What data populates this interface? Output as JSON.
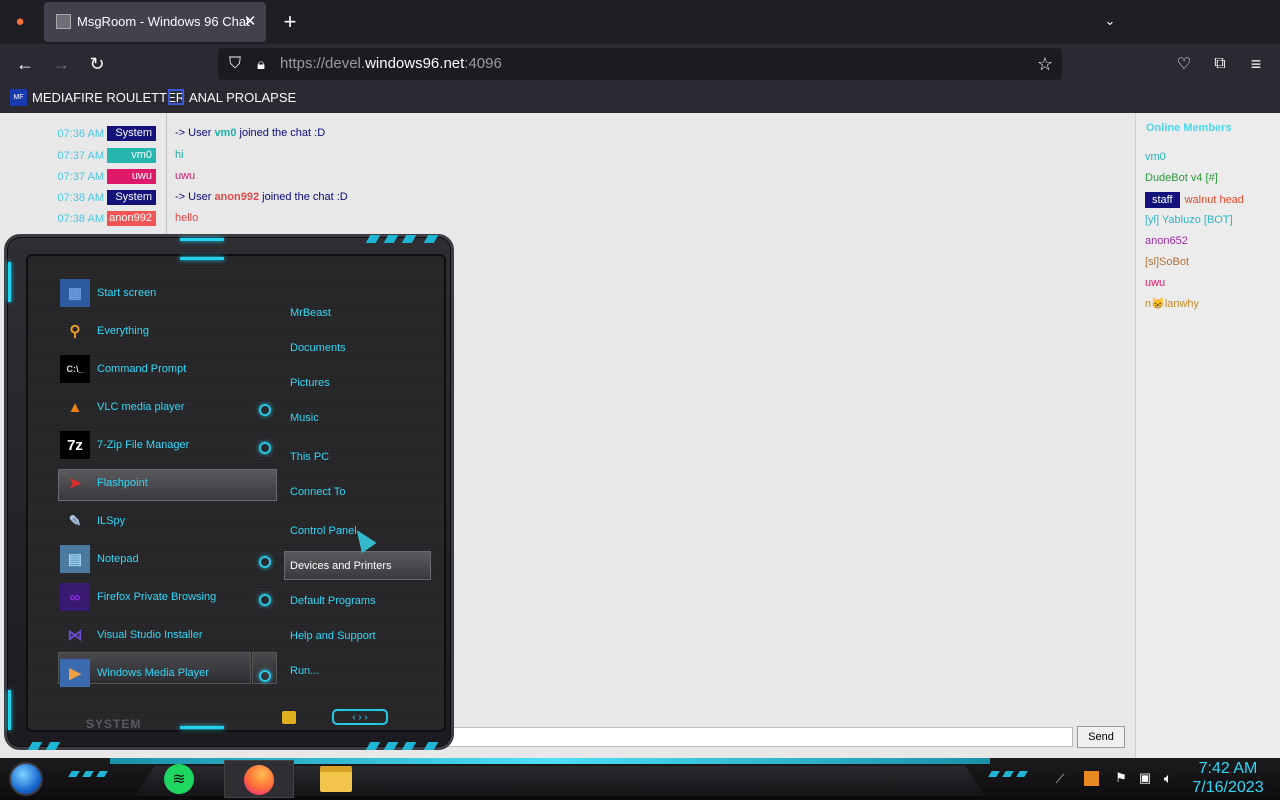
{
  "browser": {
    "tab_title": "MsgRoom - Windows 96 Chat",
    "url_prefix": "https://devel.",
    "url_host": "windows96.net",
    "url_port": ":4096",
    "bookmarks": [
      {
        "label": "MEDIAFIRE ROULETTER",
        "icon_text": "MF"
      },
      {
        "label": "ANAL PROLAPSE",
        "icon_text": ""
      }
    ]
  },
  "chat": {
    "messages": [
      {
        "time": "07:36 AM",
        "user": "System",
        "color": "#12127a",
        "text_pre": "-> User ",
        "text_user": "vm0",
        "text_user_color": "#1ab0a8",
        "text_post": " joined the chat :D",
        "text_color": "#0b0b7a"
      },
      {
        "time": "07:37 AM",
        "user": "vm0",
        "color": "#25b6b0",
        "text_pre": "hi",
        "text_user": "",
        "text_user_color": "",
        "text_post": "",
        "text_color": "#25a8a2"
      },
      {
        "time": "07:37 AM",
        "user": "uwu",
        "color": "#e0186a",
        "text_pre": "uwu",
        "text_user": "",
        "text_user_color": "",
        "text_post": "",
        "text_color": "#d21a6a"
      },
      {
        "time": "07:38 AM",
        "user": "System",
        "color": "#12127a",
        "text_pre": "-> User ",
        "text_user": "anon992",
        "text_user_color": "#e0484a",
        "text_post": " joined the chat :D",
        "text_color": "#0b0b7a"
      },
      {
        "time": "07:38 AM",
        "user": "anon992",
        "color": "#f05454",
        "text_pre": "hello",
        "text_user": "",
        "text_user_color": "",
        "text_post": "",
        "text_color": "#e04040"
      }
    ],
    "send_label": "Send",
    "input_value": ""
  },
  "members": {
    "header": "Online Members",
    "list": [
      {
        "name": "vm0",
        "color": "#25b6b0",
        "badge": ""
      },
      {
        "name": "DudeBot v4 [#]",
        "color": "#2b9a3a",
        "badge": ""
      },
      {
        "name": "walnut head",
        "color": "#e04a2a",
        "badge": "staff"
      },
      {
        "name": "[yl] Yabluzo [BOT]",
        "color": "#2fb6c8",
        "badge": ""
      },
      {
        "name": "anon652",
        "color": "#9a2aa8",
        "badge": ""
      },
      {
        "name": "[sl]SoBot",
        "color": "#b0723a",
        "badge": ""
      },
      {
        "name": "uwu",
        "color": "#e0186a",
        "badge": ""
      },
      {
        "name": "n😸lanwhy",
        "color": "#c08a2a",
        "badge": ""
      }
    ]
  },
  "start_menu": {
    "left_items": [
      {
        "label": "Start screen",
        "icon": "start-screen-icon",
        "glyph": "▦",
        "has_submenu": false
      },
      {
        "label": "Everything",
        "icon": "magnifier-icon",
        "glyph": "⚲",
        "has_submenu": false
      },
      {
        "label": "Command Prompt",
        "icon": "cmd-icon",
        "glyph": "C:\\_",
        "has_submenu": false
      },
      {
        "label": "VLC media player",
        "icon": "vlc-cone-icon",
        "glyph": "▲",
        "has_submenu": true
      },
      {
        "label": "7-Zip File Manager",
        "icon": "7zip-icon",
        "glyph": "7z",
        "has_submenu": true
      },
      {
        "label": "Flashpoint",
        "icon": "flashpoint-icon",
        "glyph": "➤",
        "has_submenu": false
      },
      {
        "label": "ILSpy",
        "icon": "ilspy-icon",
        "glyph": "✎",
        "has_submenu": false
      },
      {
        "label": "Notepad",
        "icon": "notepad-icon",
        "glyph": "▤",
        "has_submenu": true
      },
      {
        "label": "Firefox Private Browsing",
        "icon": "private-browsing-icon",
        "glyph": "∞",
        "has_submenu": true
      },
      {
        "label": "Visual Studio Installer",
        "icon": "vs-installer-icon",
        "glyph": "⋈",
        "has_submenu": false
      },
      {
        "label": "Windows Media Player",
        "icon": "media-player-icon",
        "glyph": "▶",
        "has_submenu": true
      }
    ],
    "right_items": [
      "MrBeast",
      "Documents",
      "Pictures",
      "Music",
      "This PC",
      "Connect To",
      "Control Panel",
      "Devices and Printers",
      "Default Programs",
      "Help and Support",
      "Run..."
    ],
    "footer_label": "SYSTEM"
  },
  "taskbar": {
    "time": "7:42 AM",
    "date": "7/16/2023"
  }
}
